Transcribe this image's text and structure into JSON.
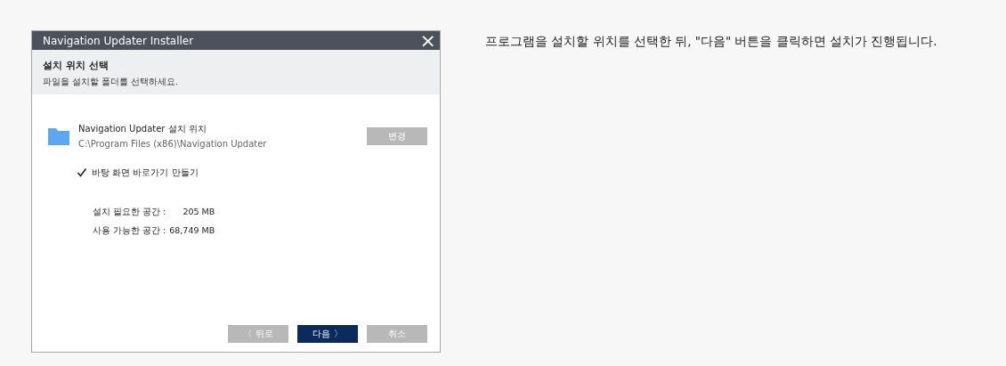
{
  "window": {
    "title": "Navigation Updater Installer",
    "close": "×"
  },
  "header": {
    "title": "설치 위치 선택",
    "subtitle": "파일을 설치할 폴더를 선택하세요."
  },
  "location": {
    "label": "Navigation Updater 설치 위치",
    "path": "C:\\Program Files (x86)\\Navigation Updater",
    "button": "변경"
  },
  "shortcut": {
    "label": "바탕 화면 바로가기 만들기",
    "checked": true
  },
  "space": [
    {
      "label": "설치 필요한 공간 :",
      "value": "205 MB"
    },
    {
      "label": "사용 가능한 공간 :",
      "value": "68,749 MB"
    }
  ],
  "buttons": [
    {
      "label": "〈 뒤로",
      "kind": "secondary"
    },
    {
      "label": "다음 〉",
      "kind": "primary"
    },
    {
      "label": "취소",
      "kind": "secondary"
    }
  ],
  "description": "프로그램을 설치할 위치를 선택한 뒤, \"다음\" 버튼을 클릭하면 설치가 진행됩니다."
}
